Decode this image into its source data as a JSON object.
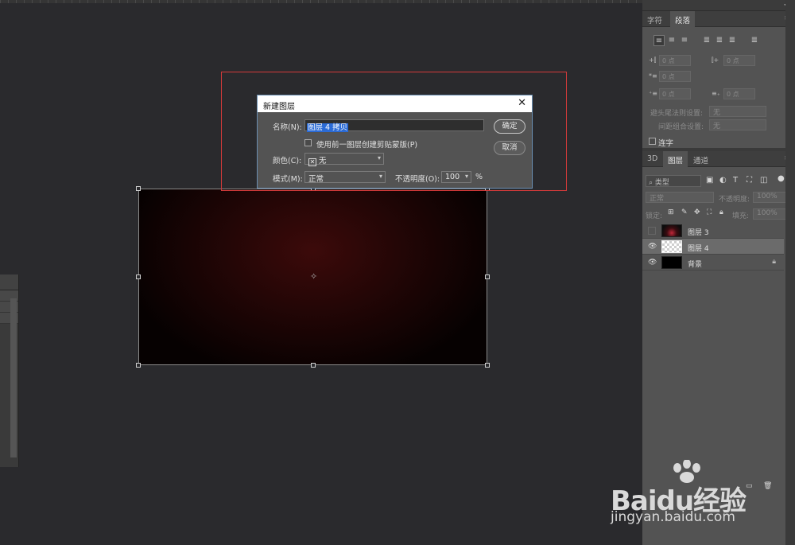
{
  "dialog": {
    "title": "新建图层",
    "name_label": "名称(N):",
    "name_value": "图层 4 拷贝",
    "clip_checkbox_label": "使用前一图层创建剪贴蒙版(P)",
    "color_label": "颜色(C):",
    "color_value": "无",
    "mode_label": "模式(M):",
    "mode_value": "正常",
    "opacity_label": "不透明度(O):",
    "opacity_value": "100",
    "opacity_unit": "%",
    "ok_label": "确定",
    "cancel_label": "取消"
  },
  "char_panel": {
    "tabs": [
      "字符",
      "段落"
    ],
    "zero_point": "0 点",
    "hyphen_label": "避头尾法则设置:",
    "hyphen_value": "无",
    "compose_label": "间距组合设置:",
    "compose_value": "无",
    "hyphenate_label": "连字"
  },
  "layers_panel": {
    "tabs": [
      "3D",
      "图层",
      "通道"
    ],
    "filter_value": "类型",
    "blend_mode": "正常",
    "opacity_label": "不透明度:",
    "opacity_value": "100%",
    "lock_label": "锁定:",
    "fill_label": "填充:",
    "fill_value": "100%",
    "layers": [
      {
        "name": "图层 3",
        "visible": false,
        "selected": false
      },
      {
        "name": "图层 4",
        "visible": true,
        "selected": true
      },
      {
        "name": "背景",
        "visible": true,
        "selected": false,
        "locked": true
      }
    ]
  },
  "watermark": {
    "logo_text": "Baidu经验",
    "url": "jingyan.baidu.com"
  },
  "colors": {
    "selection_highlight": "#2b6bd6",
    "annotation_box": "#d33a3a",
    "canvas_center": "#3c0a0a"
  }
}
